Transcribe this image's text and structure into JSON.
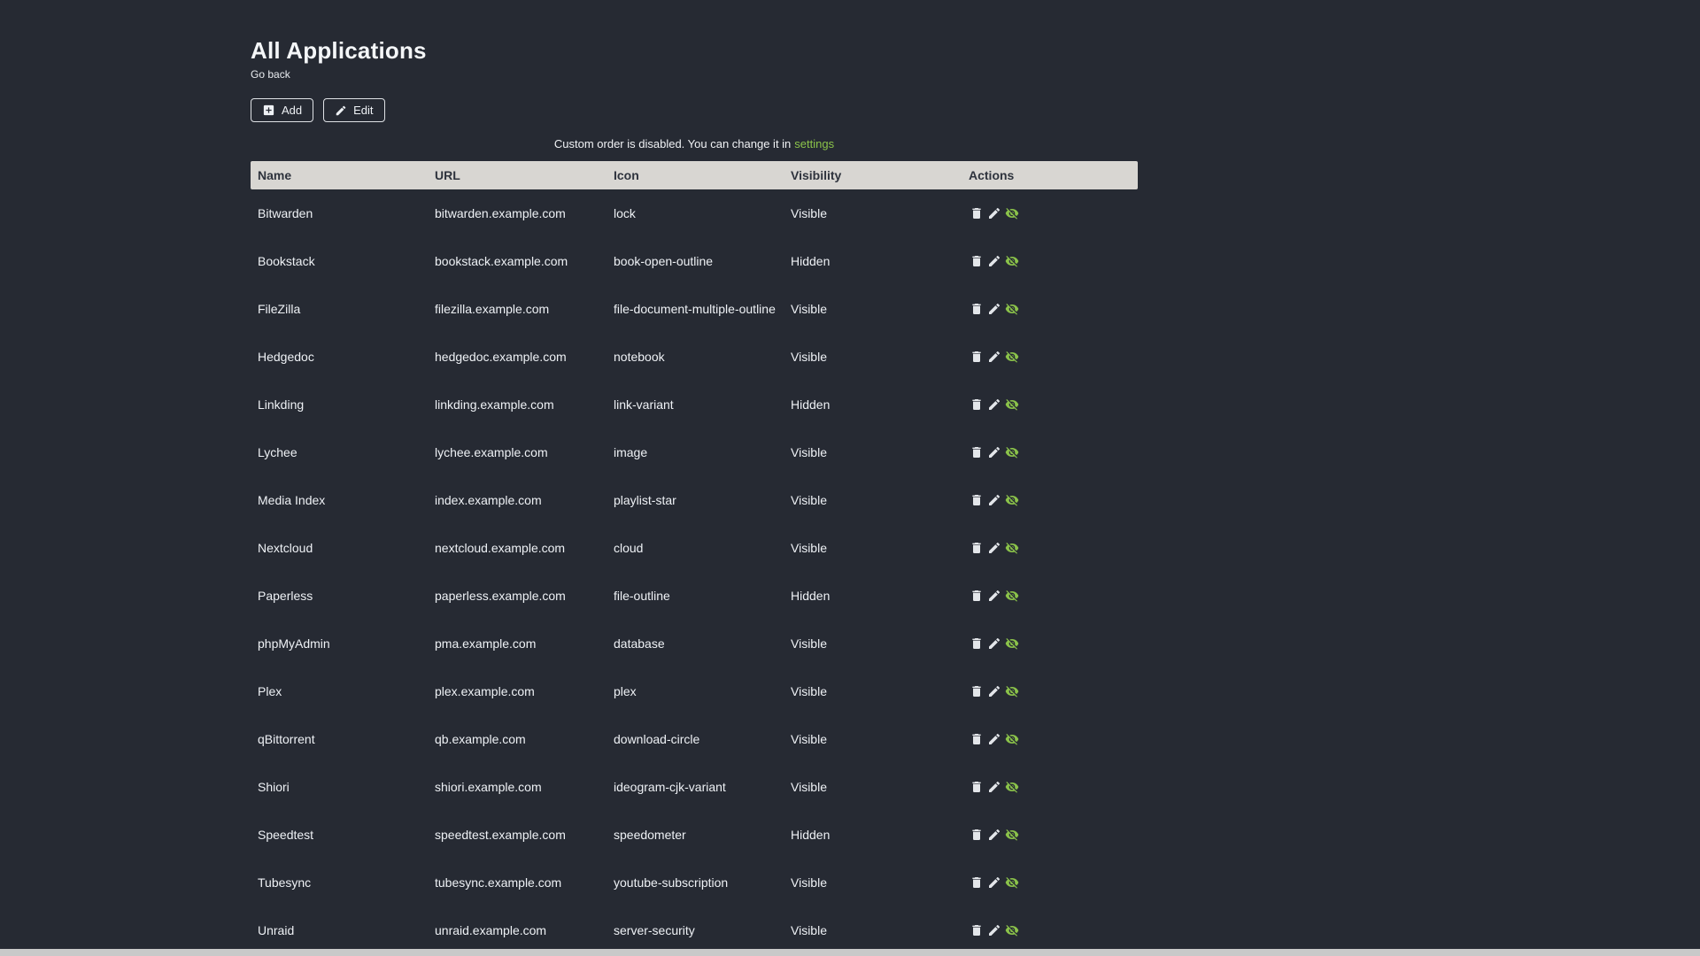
{
  "page": {
    "title": "All Applications",
    "go_back_label": "Go back"
  },
  "toolbar": {
    "add_label": "Add",
    "edit_label": "Edit",
    "add_icon": "plus-box-icon",
    "edit_icon": "pencil-icon"
  },
  "notice": {
    "text": "Custom order is disabled. You can change it in",
    "link_label": "settings"
  },
  "table": {
    "headers": [
      "Name",
      "URL",
      "Icon",
      "Visibility",
      "Actions"
    ],
    "row_action_icons": [
      "trash-icon",
      "pencil-icon",
      "eye-off-icon"
    ],
    "rows": [
      {
        "name": "Bitwarden",
        "url": "bitwarden.example.com",
        "icon": "lock",
        "visibility": "Visible"
      },
      {
        "name": "Bookstack",
        "url": "bookstack.example.com",
        "icon": "book-open-outline",
        "visibility": "Hidden"
      },
      {
        "name": "FileZilla",
        "url": "filezilla.example.com",
        "icon": "file-document-multiple-outline",
        "visibility": "Visible"
      },
      {
        "name": "Hedgedoc",
        "url": "hedgedoc.example.com",
        "icon": "notebook",
        "visibility": "Visible"
      },
      {
        "name": "Linkding",
        "url": "linkding.example.com",
        "icon": "link-variant",
        "visibility": "Hidden"
      },
      {
        "name": "Lychee",
        "url": "lychee.example.com",
        "icon": "image",
        "visibility": "Visible"
      },
      {
        "name": "Media Index",
        "url": "index.example.com",
        "icon": "playlist-star",
        "visibility": "Visible"
      },
      {
        "name": "Nextcloud",
        "url": "nextcloud.example.com",
        "icon": "cloud",
        "visibility": "Visible"
      },
      {
        "name": "Paperless",
        "url": "paperless.example.com",
        "icon": "file-outline",
        "visibility": "Hidden"
      },
      {
        "name": "phpMyAdmin",
        "url": "pma.example.com",
        "icon": "database",
        "visibility": "Visible"
      },
      {
        "name": "Plex",
        "url": "plex.example.com",
        "icon": "plex",
        "visibility": "Visible"
      },
      {
        "name": "qBittorrent",
        "url": "qb.example.com",
        "icon": "download-circle",
        "visibility": "Visible"
      },
      {
        "name": "Shiori",
        "url": "shiori.example.com",
        "icon": "ideogram-cjk-variant",
        "visibility": "Visible"
      },
      {
        "name": "Speedtest",
        "url": "speedtest.example.com",
        "icon": "speedometer",
        "visibility": "Hidden"
      },
      {
        "name": "Tubesync",
        "url": "tubesync.example.com",
        "icon": "youtube-subscription",
        "visibility": "Visible"
      },
      {
        "name": "Unraid",
        "url": "unraid.example.com",
        "icon": "server-security",
        "visibility": "Visible"
      }
    ]
  },
  "colors": {
    "background": "#262a33",
    "text": "#eef1f5",
    "accent_green": "#8bc34a",
    "table_header_bg": "#d8d6d2",
    "table_header_text": "#2e333d",
    "scrollbar": "#c9c9c9"
  }
}
